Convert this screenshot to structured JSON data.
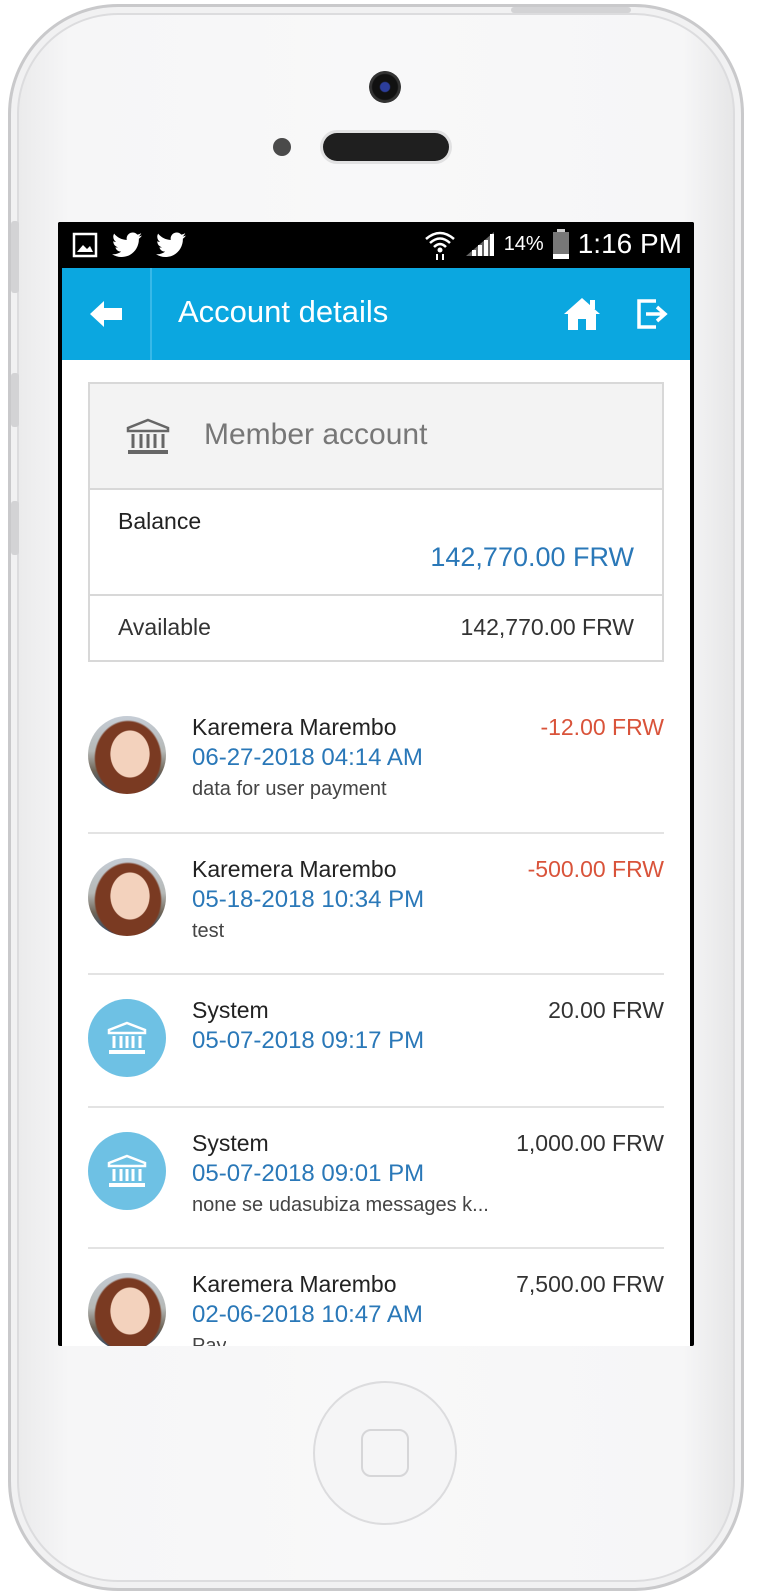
{
  "status_bar": {
    "battery": "14%",
    "time": "1:16 PM",
    "left_icons": [
      "image-icon",
      "twitter-icon",
      "twitter-icon"
    ],
    "right_icons": [
      "wifi-icon",
      "signal-icon",
      "battery-icon"
    ]
  },
  "app_bar": {
    "title": "Account details",
    "back_icon": "arrow-left-icon",
    "home_icon": "home-icon",
    "logout_icon": "logout-icon",
    "color": "#0ba7e0"
  },
  "account": {
    "title": "Member account",
    "icon": "bank-icon",
    "balance_label": "Balance",
    "balance_value": "142,770.00 FRW",
    "available_label": "Available",
    "available_value": "142,770.00 FRW"
  },
  "transactions": [
    {
      "name": "Karemera Marembo",
      "date": "06-27-2018 04:14 AM",
      "description": "data for user payment",
      "amount": "-12.00 FRW",
      "type": "person"
    },
    {
      "name": "Karemera Marembo",
      "date": "05-18-2018 10:34 PM",
      "description": "test",
      "amount": "-500.00 FRW",
      "type": "person"
    },
    {
      "name": "System",
      "date": "05-07-2018 09:17 PM",
      "description": "",
      "amount": "20.00 FRW",
      "type": "system"
    },
    {
      "name": "System",
      "date": "05-07-2018 09:01 PM",
      "description": "none se udasubiza messages k...",
      "amount": "1,000.00 FRW",
      "type": "system"
    },
    {
      "name": "Karemera Marembo",
      "date": "02-06-2018 10:47 AM",
      "description": "Pay",
      "amount": "7,500.00 FRW",
      "type": "person"
    }
  ],
  "colors": {
    "negative": "#d9533a",
    "link_blue": "#2a78b8"
  }
}
